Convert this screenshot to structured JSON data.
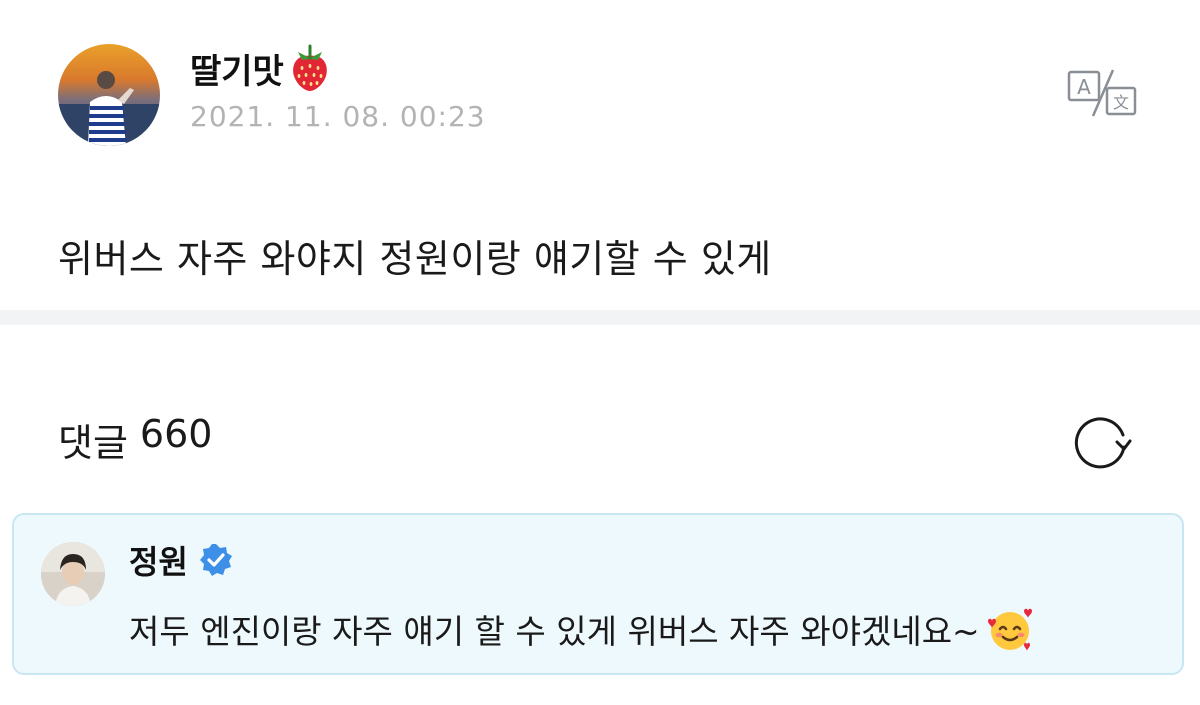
{
  "post": {
    "author_name": "딸기맛",
    "author_emoji": "strawberry-icon",
    "date": "2021. 11. 08. 00:23",
    "body": "위버스 자주 와야지 정원이랑 얘기할 수 있게",
    "translate_icon": "translate-icon"
  },
  "comments": {
    "label": "댓글",
    "count": "660",
    "refresh_icon": "refresh-icon"
  },
  "artist_comment": {
    "author_name": "정원",
    "verified_icon": "verified-badge-icon",
    "text": "저두 엔진이랑 자주 얘기 할 수 있게 위버스 자주 와야겠네요~",
    "trailing_emoji": "smiling-face-with-hearts-icon"
  },
  "colors": {
    "date_gray": "#b3b3b3",
    "separator": "#f2f3f5",
    "card_background": "#eef9fd",
    "card_border": "#c9e7f1",
    "verified_blue": "#3d8fe8"
  }
}
